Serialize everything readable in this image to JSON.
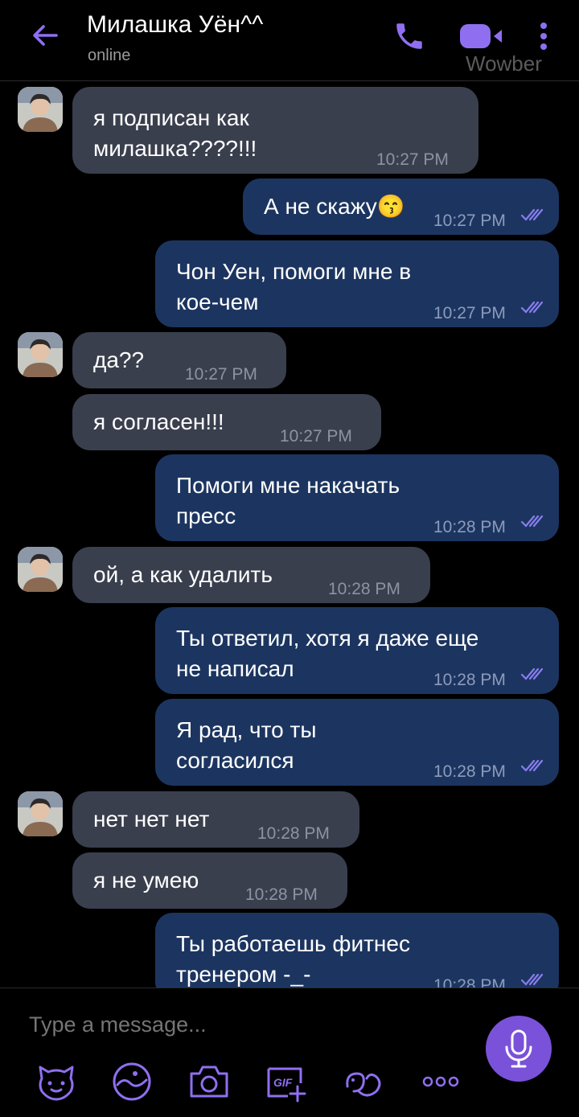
{
  "header": {
    "title": "Милашка Уён^^",
    "status": "online",
    "watermark": "Wowber"
  },
  "messages": [
    {
      "dir": "in",
      "lines": [
        "я подписан как",
        "милашка????!!!"
      ],
      "time": "10:27 PM",
      "avatar": true
    },
    {
      "dir": "out",
      "lines": [
        "А не скажу😙"
      ],
      "time": "10:27 PM",
      "read": true
    },
    {
      "dir": "out",
      "lines": [
        "Чон Уен, помоги мне в",
        "кое-чем"
      ],
      "time": "10:27 PM",
      "read": true
    },
    {
      "dir": "in",
      "lines": [
        "да??"
      ],
      "time": "10:27 PM",
      "avatar": true
    },
    {
      "dir": "in",
      "lines": [
        "я согласен!!!"
      ],
      "time": "10:27 PM",
      "avatar": false
    },
    {
      "dir": "out",
      "lines": [
        "Помоги мне накачать",
        "пресс"
      ],
      "time": "10:28 PM",
      "read": true
    },
    {
      "dir": "in",
      "lines": [
        "ой, а как удалить"
      ],
      "time": "10:28 PM",
      "avatar": true
    },
    {
      "dir": "out",
      "lines": [
        "Ты ответил, хотя я даже еще",
        "не написал"
      ],
      "time": "10:28 PM",
      "read": true
    },
    {
      "dir": "out",
      "lines": [
        "Я рад, что ты",
        "согласился"
      ],
      "time": "10:28 PM",
      "read": true
    },
    {
      "dir": "in",
      "lines": [
        "нет нет нет"
      ],
      "time": "10:28 PM",
      "avatar": true
    },
    {
      "dir": "in",
      "lines": [
        "я не умею"
      ],
      "time": "10:28 PM",
      "avatar": false
    },
    {
      "dir": "out",
      "lines": [
        "Ты работаешь фитнес",
        "тренером -_-"
      ],
      "time": "10:28 PM",
      "read": true
    }
  ],
  "composer": {
    "placeholder": "Type a message...",
    "tools": [
      "sticker-icon",
      "doodle-icon",
      "camera-icon",
      "gif-icon",
      "emoji-icon",
      "more-icon"
    ],
    "gif_label": "GIF"
  },
  "colors": {
    "accent": "#7a52d9",
    "incoming_bubble": "#3a3f4e",
    "outgoing_bubble": "#1c3560",
    "read_ticks": "#8a7cf0"
  }
}
